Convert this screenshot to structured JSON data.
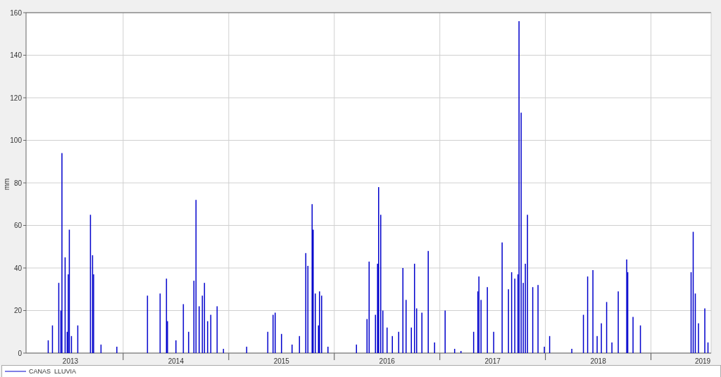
{
  "chart": {
    "chart_data": {
      "type": "bar",
      "grid": true,
      "ylabel": "mm",
      "xlim": [
        2013.08,
        2019.57
      ],
      "ylim": [
        0,
        160
      ],
      "yticks": [
        0,
        20,
        40,
        60,
        80,
        100,
        120,
        140,
        160
      ],
      "xticks": [
        {
          "value": 2013.5,
          "label": "2013"
        },
        {
          "value": 2014.5,
          "label": "2014"
        },
        {
          "value": 2015.5,
          "label": "2015"
        },
        {
          "value": 2016.5,
          "label": "2016"
        },
        {
          "value": 2017.5,
          "label": "2017"
        },
        {
          "value": 2018.5,
          "label": "2018"
        },
        {
          "value": 2019.49,
          "label": "2019"
        }
      ],
      "x": [
        2013.29,
        2013.33,
        2013.39,
        2013.41,
        2013.42,
        2013.45,
        2013.47,
        2013.48,
        2013.49,
        2013.51,
        2013.57,
        2013.69,
        2013.71,
        2013.72,
        2013.79,
        2013.94,
        2014.23,
        2014.35,
        2014.41,
        2014.42,
        2014.5,
        2014.57,
        2014.62,
        2014.67,
        2014.69,
        2014.72,
        2014.75,
        2014.77,
        2014.8,
        2014.83,
        2014.89,
        2014.95,
        2015.17,
        2015.37,
        2015.42,
        2015.44,
        2015.5,
        2015.6,
        2015.67,
        2015.73,
        2015.75,
        2015.79,
        2015.8,
        2015.82,
        2015.85,
        2015.86,
        2015.88,
        2015.94,
        2016.21,
        2016.31,
        2016.33,
        2016.39,
        2016.41,
        2016.42,
        2016.44,
        2016.46,
        2016.5,
        2016.55,
        2016.61,
        2016.65,
        2016.68,
        2016.73,
        2016.76,
        2016.78,
        2016.83,
        2016.89,
        2016.95,
        2017.05,
        2017.14,
        2017.2,
        2017.32,
        2017.36,
        2017.37,
        2017.39,
        2017.45,
        2017.51,
        2017.59,
        2017.65,
        2017.68,
        2017.71,
        2017.74,
        2017.75,
        2017.77,
        2017.79,
        2017.81,
        2017.83,
        2017.88,
        2017.93,
        2017.99,
        2018.04,
        2018.25,
        2018.36,
        2018.4,
        2018.45,
        2018.49,
        2018.53,
        2018.58,
        2018.63,
        2018.69,
        2018.77,
        2018.78,
        2018.83,
        2018.9,
        2019.38,
        2019.4,
        2019.42,
        2019.45,
        2019.51,
        2019.54
      ],
      "series": [
        {
          "name": "CANAS  LLUVIA",
          "color": "#0000cc",
          "values": [
            6,
            13,
            33,
            20,
            94,
            45,
            10,
            37,
            58,
            8,
            13,
            65,
            46,
            37,
            4,
            3,
            27,
            28,
            35,
            15,
            6,
            23,
            10,
            34,
            72,
            22,
            27,
            33,
            15,
            18,
            22,
            2,
            3,
            10,
            18,
            19,
            9,
            4,
            8,
            47,
            41,
            70,
            58,
            28,
            13,
            29,
            27,
            3,
            4,
            16,
            43,
            18,
            42,
            78,
            65,
            20,
            12,
            8,
            10,
            40,
            25,
            12,
            42,
            21,
            19,
            48,
            5,
            20,
            2,
            1,
            10,
            29,
            36,
            25,
            31,
            10,
            52,
            30,
            38,
            35,
            37,
            156,
            113,
            33,
            42,
            65,
            31,
            32,
            3,
            8,
            2,
            18,
            36,
            39,
            8,
            14,
            24,
            5,
            29,
            44,
            38,
            17,
            13,
            38,
            57,
            28,
            14,
            21,
            5
          ]
        }
      ]
    }
  }
}
